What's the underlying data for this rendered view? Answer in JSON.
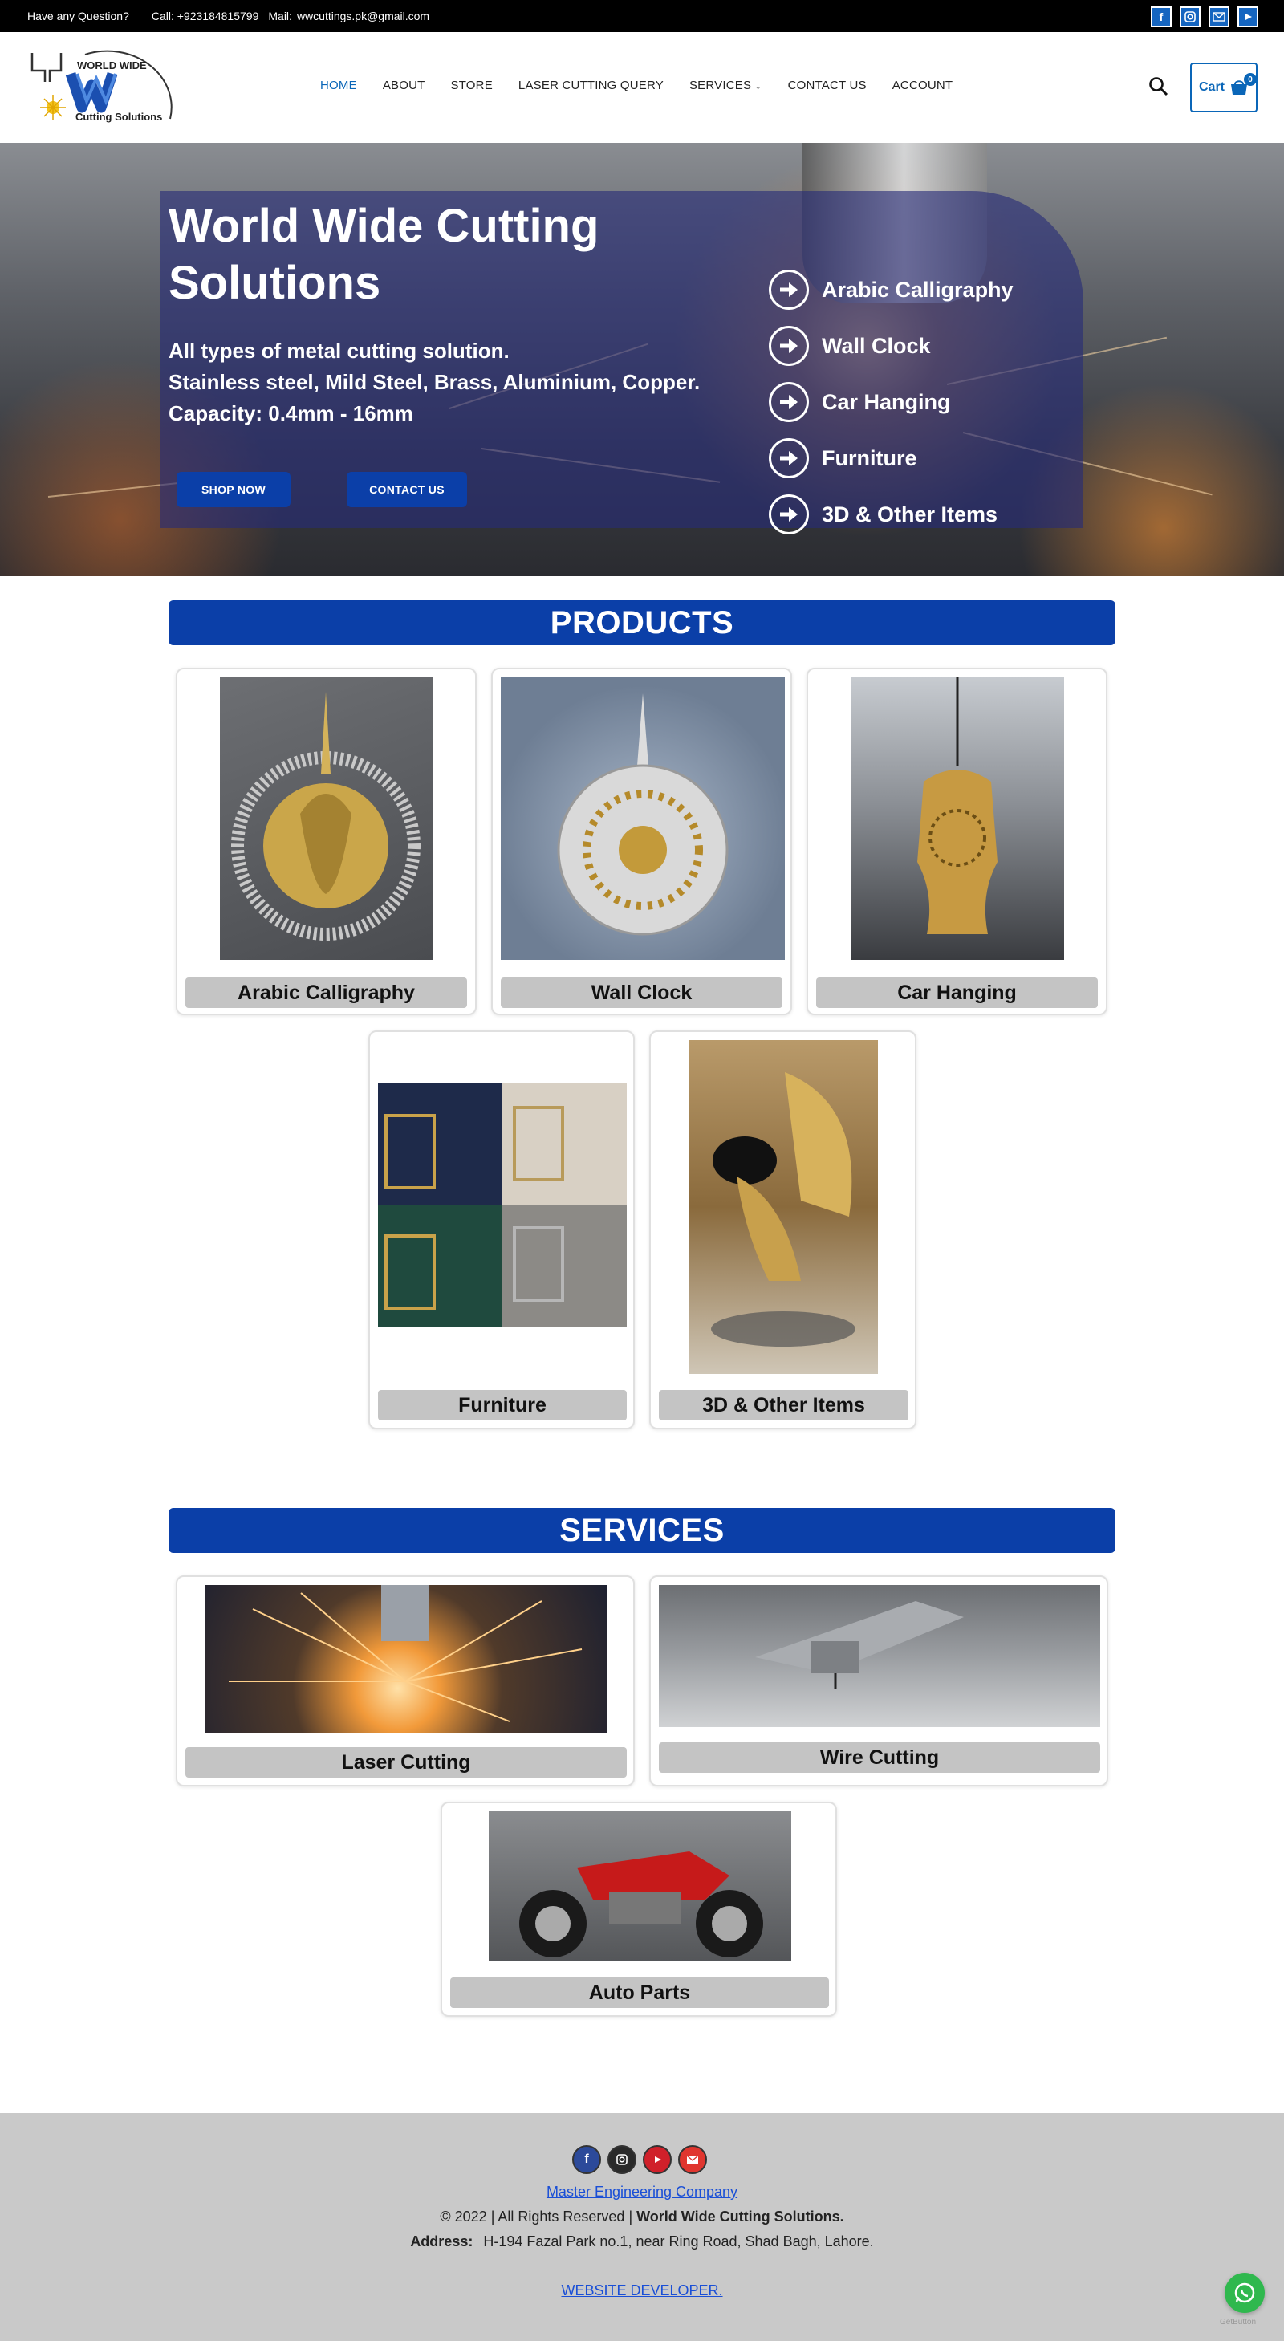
{
  "topbar": {
    "question": "Have any Question?",
    "call": "Call: +923184815799",
    "mail_label": "Mail:",
    "mail": "wwcuttings.pk@gmail.com",
    "socials": [
      "facebook-icon",
      "instagram-icon",
      "mail-icon",
      "youtube-icon"
    ]
  },
  "logo": {
    "line1": "WORLD WIDE",
    "line2": "Cutting Solutions",
    "mark": "W"
  },
  "nav": {
    "items": [
      "HOME",
      "ABOUT",
      "STORE",
      "LASER CUTTING QUERY",
      "SERVICES",
      "CONTACT US",
      "ACCOUNT"
    ],
    "active": "HOME"
  },
  "cart": {
    "label": "Cart",
    "count": "0"
  },
  "hero": {
    "title": "World Wide Cutting Solutions",
    "line1": "All types of metal cutting solution.",
    "line2": "Stainless steel, Mild Steel, Brass, Aluminium, Copper.",
    "line3": "Capacity: 0.4mm - 16mm",
    "shop_now": "SHOP NOW",
    "contact_us": "CONTACT US",
    "list": [
      "Arabic Calligraphy",
      "Wall Clock",
      "Car Hanging",
      "Furniture",
      "3D & Other Items"
    ]
  },
  "products": {
    "heading": "PRODUCTS",
    "items": [
      "Arabic Calligraphy",
      "Wall Clock",
      "Car Hanging",
      "Furniture",
      "3D & Other Items"
    ]
  },
  "services": {
    "heading": "SERVICES",
    "items": [
      "Laser Cutting",
      "Wire Cutting",
      "Auto Parts"
    ]
  },
  "footer": {
    "company_link": "Master Engineering Company",
    "copyright_prefix": "© 2022 | All Rights Reserved |",
    "copyright_brand": "World Wide Cutting Solutions.",
    "address_label": "Address:",
    "address": "H-194 Fazal Park no.1, near Ring Road, Shad Bagh, Lahore.",
    "developer_link": "WEBSITE DEVELOPER.",
    "icons": [
      "facebook-icon",
      "instagram-icon",
      "youtube-icon",
      "mail-icon"
    ]
  },
  "widget": {
    "getbutton": "GetButton"
  },
  "colors": {
    "brand_blue": "#0b3fa8",
    "link_blue": "#0a66b8",
    "topbar": "#000000",
    "footer_bg": "#c9c9c9",
    "whatsapp": "#2fb84e"
  }
}
